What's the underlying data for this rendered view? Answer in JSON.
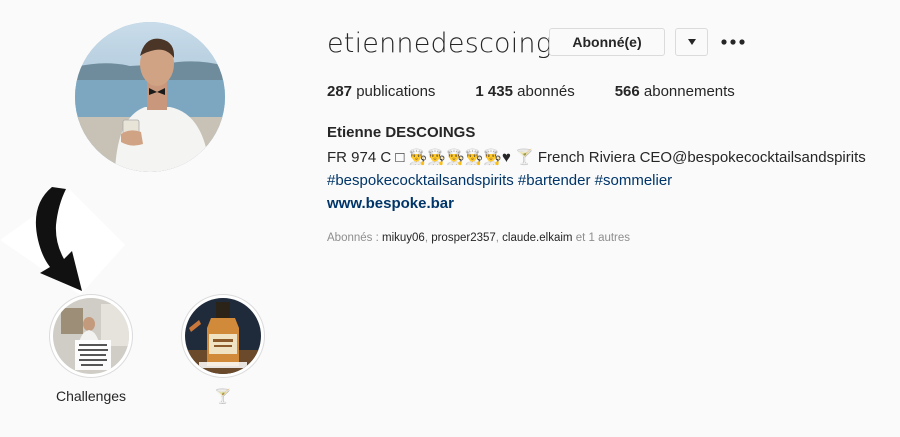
{
  "profile": {
    "username": "etiennedescoings",
    "follow_button": "Abonné(e)",
    "dropdown_icon": "caret-down-icon",
    "more_icon": "more-options-icon",
    "stats": {
      "posts_count": "287",
      "posts_label": " publications",
      "followers_count": "1 435",
      "followers_label": " abonnés",
      "following_count": "566",
      "following_label": " abonnements"
    },
    "full_name": "Etienne DESCOINGS",
    "bio_line1": "FR 974 C □ 👨‍🍳👨‍🍳👨‍🍳👨‍🍳👨‍🍳♥ 🍸 French Riviera CEO@bespokecocktailsandspirits",
    "bio_line2": "#bespokecocktailsandspirits #bartender #sommelier",
    "website": "www.bespoke.bar",
    "followed_by": {
      "prefix": "Abonnés : ",
      "user1": "mikuy06",
      "sep1": ", ",
      "user2": "prosper2357",
      "sep2": ", ",
      "user3": "claude.elkaim",
      "suffix": " et 1 autres"
    }
  },
  "highlights": [
    {
      "label": "Challenges"
    },
    {
      "label": "🍸"
    }
  ],
  "annotation": {
    "icon": "curved-arrow-icon"
  }
}
